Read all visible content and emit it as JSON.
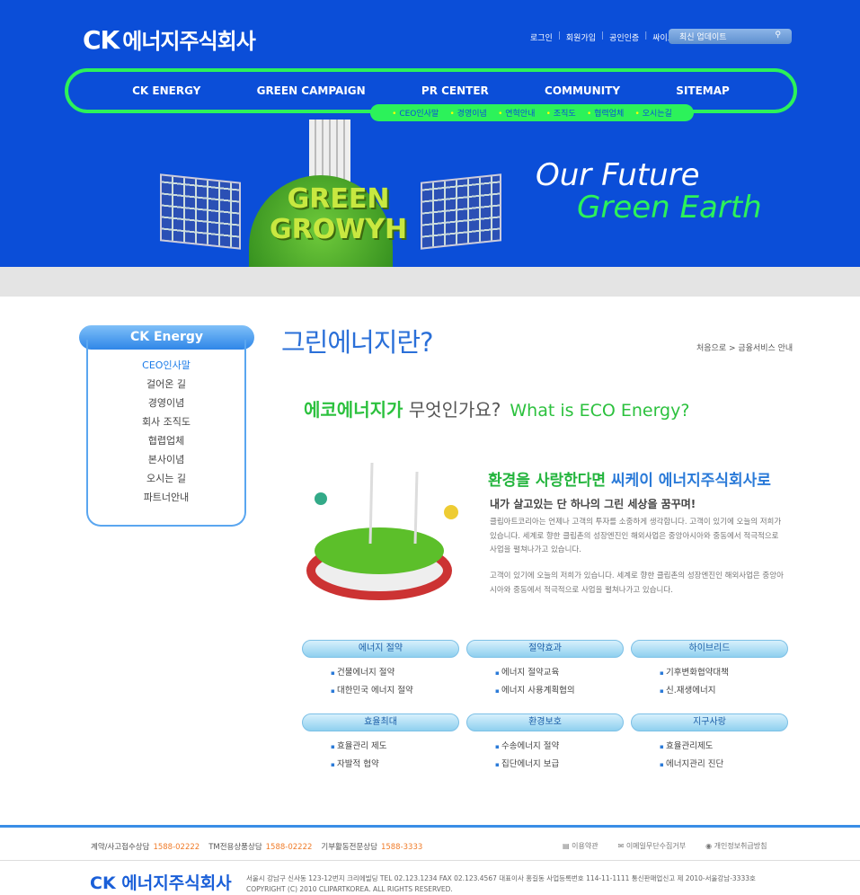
{
  "header": {
    "logo_mark": "CK",
    "logo_text": "에너지주식회사",
    "util_links": [
      "로그인",
      "회원가입",
      "공인인증",
      "싸이트맵"
    ],
    "search_placeholder": "최신 업데이트",
    "nav": [
      "CK ENERGY",
      "GREEN CAMPAIGN",
      "PR CENTER",
      "COMMUNITY",
      "SITEMAP"
    ],
    "subnav": [
      "CEO인사말",
      "경영이념",
      "연혁안내",
      "조직도",
      "협력업체",
      "오시는길"
    ]
  },
  "banner": {
    "line1": "Our Future",
    "line2": "Green Earth",
    "globe_text": [
      "GREEN",
      "GROWYH"
    ]
  },
  "sidebar": {
    "title": "CK Energy",
    "items": [
      "CEO인사말",
      "걸어온 길",
      "경영이념",
      "회사 조직도",
      "협렵업체",
      "본사이념",
      "오시는 길",
      "파트너안내"
    ],
    "active": 0
  },
  "main": {
    "title": "그린에너지란?",
    "breadcrumb": "처음으로 > 금융서비스 안내",
    "question_green": "에코에너지가",
    "question_rest": " 무엇인가요?",
    "question_en": "What is ECO Energy?",
    "headline_green": "환경을 사랑한다면 ",
    "headline_blue": "씨케이 에너지주식회사로",
    "subheadline": "내가 살고있는 단 하나의 그린 세상을  꿈꾸며!",
    "para1": "클립아트코리아는 언제나 고객의 투자를 소중하게 생각합니다. 고객이 있기에 오늘의 저희가 있습니다. 세계로 향한 클립촌의 성장엔진인 해외사업은 중앙아시아와 중동에서 적극적으로 사업을 펼쳐나가고 있습니다.",
    "para2": "고객이 있기에 오늘의 저희가 있습니다. 세계로 향한 클립촌의 성장엔진인 해외사업은 중앙아시아와 중동에서 적극적으로 사업을 펼쳐나가고 있습니다.",
    "categories": [
      {
        "title": "에너지 절약",
        "items": [
          "건물에너지 절약",
          "대한민국 에너지 절약"
        ]
      },
      {
        "title": "절약효과",
        "items": [
          "에너지 절약교육",
          "에너지 사용계획협의"
        ]
      },
      {
        "title": "하이브리드",
        "items": [
          "기후변화협약대책",
          "신.재생에너지"
        ]
      },
      {
        "title": "효율최대",
        "items": [
          "효율관리 제도",
          "자발적 협약"
        ]
      },
      {
        "title": "환경보호",
        "items": [
          "수송에너지 절약",
          "집단에너지 보급"
        ]
      },
      {
        "title": "지구사랑",
        "items": [
          "효율관리제도",
          "에너지관리 진단"
        ]
      }
    ]
  },
  "footer": {
    "contacts": [
      {
        "label": "계약/사고접수상담",
        "number": "1588-02222"
      },
      {
        "label": "TM전용상품상담",
        "number": "1588-02222"
      },
      {
        "label": "기부활동전문상담",
        "number": "1588-3333"
      }
    ],
    "links": [
      "이용약관",
      "이메일무단수집거부",
      "개인정보취급방침"
    ],
    "logo_mark": "CK",
    "logo_text": "에너지주식회사",
    "address": "서울시 강남구 신사동 123-12번지 크리에빌딩  TEL 02.123.1234   FAX 02.123.4567  대표이사 홍길동 사업등록번호 114-11-1111 통신판매업신고 제 2010-서울강남-3333호",
    "copyright": "COPYRIGHT (C) 2010 CLIPARTKOREA. ALL RIGHTS RESERVED."
  }
}
